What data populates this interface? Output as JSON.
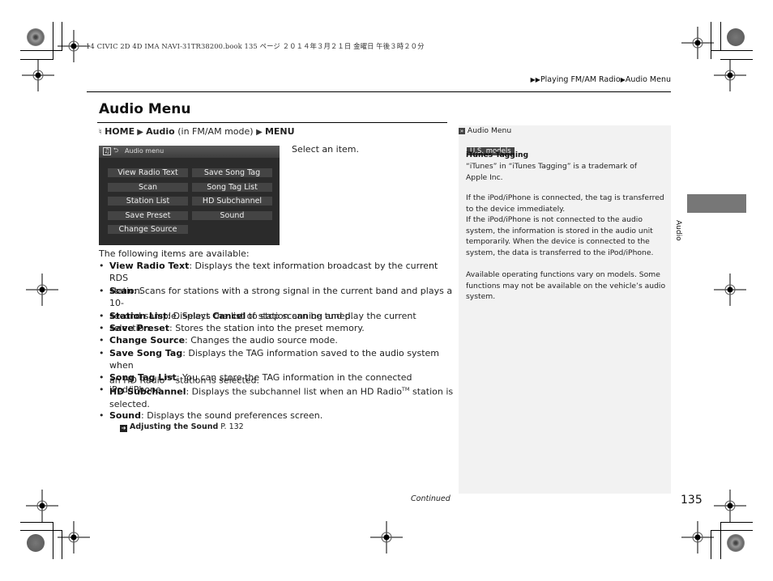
{
  "print_header": "14 CIVIC 2D 4D IMA NAVI-31TR38200.book  135 ページ  ２０１４年３月２１日  金曜日  午後３時２０分",
  "breadcrumb": {
    "arrows": "▶▶",
    "parent": "Playing FM/AM Radio",
    "separator": "▶",
    "current": "Audio Menu"
  },
  "page_title": "Audio Menu",
  "nav_path": {
    "icon": "voice-control-icon",
    "home": "HOME",
    "sep1": " ▶ ",
    "audio": "Audio",
    "mode": " (in FM/AM mode) ",
    "sep2": "▶ ",
    "menu": "MENU"
  },
  "screen": {
    "title": "Audio menu",
    "icons": [
      "music-note-icon",
      "back-icon"
    ],
    "left_items": [
      "View Radio Text",
      "Scan",
      "Station List",
      "Save Preset",
      "Change Source"
    ],
    "right_items": [
      "Save Song Tag",
      "Song Tag List",
      "HD Subchannel",
      "Sound"
    ]
  },
  "select_instruction": "Select an item.",
  "intro": "The following items are available:",
  "items": [
    {
      "term": "View Radio Text",
      "desc1": ": Displays the text information broadcast by the current RDS",
      "desc2": "station."
    },
    {
      "term": "Scan",
      "desc1": ": Scans for stations with a strong signal in the current band and plays a 10-",
      "desc2a": "second sample. Select ",
      "desc2b": "Cancel",
      "desc2c": " to stop scanning and play the current selection."
    },
    {
      "term": "Station List",
      "desc1": ": Displays the list of station can be tuned."
    },
    {
      "term": "Save Preset",
      "desc1": ": Stores the station into the preset memory."
    },
    {
      "term": "Change Source",
      "desc1": ": Changes the audio source mode."
    },
    {
      "term": "Save Song Tag",
      "desc1": ": Displays the TAG information saved to the audio system when",
      "desc2a": "an HD Radio",
      "tm": "TM",
      "desc2c": " station is selected."
    },
    {
      "term": "Song Tag List",
      "desc1": ": You can store the TAG information in the connected iPod/iPhone."
    },
    {
      "term": "HD Subchannel",
      "desc1": ": Displays the subchannel list when an HD Radio",
      "tm": "TM",
      "desc1b": " station is",
      "desc2": "selected."
    },
    {
      "term": "Sound",
      "desc1": ": Displays the sound preferences screen."
    }
  ],
  "cross_ref": {
    "icon": "arrow-ref-icon",
    "label": "Adjusting the Sound",
    "page": " P. 132"
  },
  "sidebar": {
    "heading_icon": "double-chevron-icon",
    "heading": "Audio Menu",
    "badge": "U.S. models",
    "subheading": "iTunes Tagging",
    "trademark": [
      "“iTunes” in “iTunes Tagging” is a trademark of",
      "Apple Inc."
    ],
    "para1": [
      "If the iPod/iPhone is connected, the tag is transferred",
      "to the device immediately.",
      "If the iPod/iPhone is not connected to the audio",
      "system, the information is stored in the audio unit",
      "temporarily. When the device is connected to the",
      "system, the data is transferred to the iPod/iPhone."
    ],
    "para2": [
      "Available operating functions vary on models. Some",
      "functions may not be available on the vehicle’s audio",
      "system."
    ]
  },
  "section_tab": "Audio",
  "continued": "Continued",
  "page_number": "135",
  "colors": {
    "tab": "#777777",
    "sidebox": "#f2f2f2",
    "screen_bg": "#2b2b2b",
    "badge": "#444444"
  }
}
